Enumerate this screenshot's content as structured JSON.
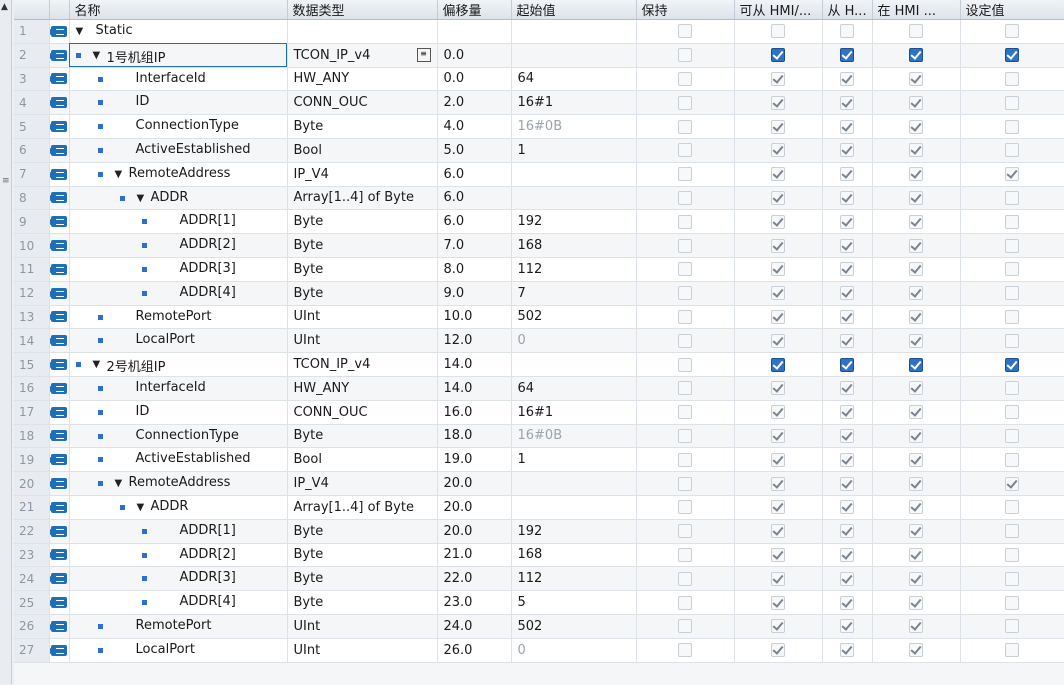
{
  "columns": {
    "name": "名称",
    "data_type": "数据类型",
    "offset": "偏移量",
    "start_value": "起始值",
    "retain": "保持",
    "accessible_hmi": "可从 HMI/...",
    "writable_hmi": "从 H...",
    "visible_hmi": "在 HMI ...",
    "setpoint": "设定值"
  },
  "rows": [
    {
      "num": "1",
      "level": 0,
      "expand": true,
      "bullet": false,
      "name": "Static",
      "type": "",
      "offset": "",
      "start": "",
      "retain": false,
      "c1": false,
      "c2": false,
      "c3": false,
      "set": false,
      "dis": true
    },
    {
      "num": "2",
      "level": 1,
      "expand": true,
      "bullet": true,
      "name": "1号机组IP",
      "type": "TCON_IP_v4",
      "offset": "0.0",
      "start": "",
      "retain": false,
      "c1": true,
      "c2": true,
      "c3": true,
      "set": true,
      "blue": true,
      "selected": true,
      "typebtn": true
    },
    {
      "num": "3",
      "level": 2,
      "bullet": true,
      "name": "InterfaceId",
      "type": "HW_ANY",
      "offset": "0.0",
      "start": "64",
      "retain": false,
      "c1": true,
      "c2": true,
      "c3": true,
      "set": false
    },
    {
      "num": "4",
      "level": 2,
      "bullet": true,
      "name": "ID",
      "type": "CONN_OUC",
      "offset": "2.0",
      "start": "16#1",
      "retain": false,
      "c1": true,
      "c2": true,
      "c3": true,
      "set": false
    },
    {
      "num": "5",
      "level": 2,
      "bullet": true,
      "name": "ConnectionType",
      "type": "Byte",
      "offset": "4.0",
      "start": "16#0B",
      "startGray": true,
      "retain": false,
      "c1": true,
      "c2": true,
      "c3": true,
      "set": false
    },
    {
      "num": "6",
      "level": 2,
      "bullet": true,
      "name": "ActiveEstablished",
      "type": "Bool",
      "offset": "5.0",
      "start": "1",
      "retain": false,
      "c1": true,
      "c2": true,
      "c3": true,
      "set": false
    },
    {
      "num": "7",
      "level": 2,
      "expand": true,
      "bullet": true,
      "name": "RemoteAddress",
      "type": "IP_V4",
      "offset": "6.0",
      "start": "",
      "retain": false,
      "c1": true,
      "c2": true,
      "c3": true,
      "set": true
    },
    {
      "num": "8",
      "level": 3,
      "expand": true,
      "bullet": true,
      "name": "ADDR",
      "type": "Array[1..4] of Byte",
      "offset": "6.0",
      "start": "",
      "retain": false,
      "c1": true,
      "c2": true,
      "c3": true,
      "set": false
    },
    {
      "num": "9",
      "level": 4,
      "bullet": true,
      "name": "ADDR[1]",
      "type": "Byte",
      "offset": "6.0",
      "start": "192",
      "retain": false,
      "c1": true,
      "c2": true,
      "c3": true,
      "set": false
    },
    {
      "num": "10",
      "level": 4,
      "bullet": true,
      "name": "ADDR[2]",
      "type": "Byte",
      "offset": "7.0",
      "start": "168",
      "retain": false,
      "c1": true,
      "c2": true,
      "c3": true,
      "set": false
    },
    {
      "num": "11",
      "level": 4,
      "bullet": true,
      "name": "ADDR[3]",
      "type": "Byte",
      "offset": "8.0",
      "start": "112",
      "retain": false,
      "c1": true,
      "c2": true,
      "c3": true,
      "set": false
    },
    {
      "num": "12",
      "level": 4,
      "bullet": true,
      "name": "ADDR[4]",
      "type": "Byte",
      "offset": "9.0",
      "start": "7",
      "retain": false,
      "c1": true,
      "c2": true,
      "c3": true,
      "set": false
    },
    {
      "num": "13",
      "level": 2,
      "bullet": true,
      "name": "RemotePort",
      "type": "UInt",
      "offset": "10.0",
      "start": "502",
      "retain": false,
      "c1": true,
      "c2": true,
      "c3": true,
      "set": false
    },
    {
      "num": "14",
      "level": 2,
      "bullet": true,
      "name": "LocalPort",
      "type": "UInt",
      "offset": "12.0",
      "start": "0",
      "startGray": true,
      "retain": false,
      "c1": true,
      "c2": true,
      "c3": true,
      "set": false
    },
    {
      "num": "15",
      "level": 1,
      "expand": true,
      "bullet": true,
      "name": "2号机组IP",
      "type": "TCON_IP_v4",
      "offset": "14.0",
      "start": "",
      "retain": false,
      "c1": true,
      "c2": true,
      "c3": true,
      "set": true,
      "blue": true
    },
    {
      "num": "16",
      "level": 2,
      "bullet": true,
      "name": "InterfaceId",
      "type": "HW_ANY",
      "offset": "14.0",
      "start": "64",
      "retain": false,
      "c1": true,
      "c2": true,
      "c3": true,
      "set": false
    },
    {
      "num": "17",
      "level": 2,
      "bullet": true,
      "name": "ID",
      "type": "CONN_OUC",
      "offset": "16.0",
      "start": "16#1",
      "retain": false,
      "c1": true,
      "c2": true,
      "c3": true,
      "set": false
    },
    {
      "num": "18",
      "level": 2,
      "bullet": true,
      "name": "ConnectionType",
      "type": "Byte",
      "offset": "18.0",
      "start": "16#0B",
      "startGray": true,
      "retain": false,
      "c1": true,
      "c2": true,
      "c3": true,
      "set": false
    },
    {
      "num": "19",
      "level": 2,
      "bullet": true,
      "name": "ActiveEstablished",
      "type": "Bool",
      "offset": "19.0",
      "start": "1",
      "retain": false,
      "c1": true,
      "c2": true,
      "c3": true,
      "set": false
    },
    {
      "num": "20",
      "level": 2,
      "expand": true,
      "bullet": true,
      "name": "RemoteAddress",
      "type": "IP_V4",
      "offset": "20.0",
      "start": "",
      "retain": false,
      "c1": true,
      "c2": true,
      "c3": true,
      "set": true
    },
    {
      "num": "21",
      "level": 3,
      "expand": true,
      "bullet": true,
      "name": "ADDR",
      "type": "Array[1..4] of Byte",
      "offset": "20.0",
      "start": "",
      "retain": false,
      "c1": true,
      "c2": true,
      "c3": true,
      "set": false
    },
    {
      "num": "22",
      "level": 4,
      "bullet": true,
      "name": "ADDR[1]",
      "type": "Byte",
      "offset": "20.0",
      "start": "192",
      "retain": false,
      "c1": true,
      "c2": true,
      "c3": true,
      "set": false
    },
    {
      "num": "23",
      "level": 4,
      "bullet": true,
      "name": "ADDR[2]",
      "type": "Byte",
      "offset": "21.0",
      "start": "168",
      "retain": false,
      "c1": true,
      "c2": true,
      "c3": true,
      "set": false
    },
    {
      "num": "24",
      "level": 4,
      "bullet": true,
      "name": "ADDR[3]",
      "type": "Byte",
      "offset": "22.0",
      "start": "112",
      "retain": false,
      "c1": true,
      "c2": true,
      "c3": true,
      "set": false
    },
    {
      "num": "25",
      "level": 4,
      "bullet": true,
      "name": "ADDR[4]",
      "type": "Byte",
      "offset": "23.0",
      "start": "5",
      "retain": false,
      "c1": true,
      "c2": true,
      "c3": true,
      "set": false
    },
    {
      "num": "26",
      "level": 2,
      "bullet": true,
      "name": "RemotePort",
      "type": "UInt",
      "offset": "24.0",
      "start": "502",
      "retain": false,
      "c1": true,
      "c2": true,
      "c3": true,
      "set": false
    },
    {
      "num": "27",
      "level": 2,
      "bullet": true,
      "name": "LocalPort",
      "type": "UInt",
      "offset": "26.0",
      "start": "0",
      "startGray": true,
      "retain": false,
      "c1": true,
      "c2": true,
      "c3": true,
      "set": false
    }
  ],
  "icons": {
    "row_icon": "db-tag-icon",
    "bullet": "member-bullet-icon",
    "expand": "expand-triangle-icon",
    "checkbox": "checkbox-icon",
    "type_button": "type-picker-icon"
  },
  "colors": {
    "accent": "#1e6fb6",
    "checkbox_blue": "#2e73c8"
  }
}
